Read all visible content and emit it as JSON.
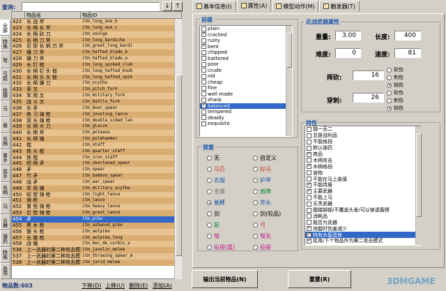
{
  "search": {
    "label": "查询:",
    "value": ""
  },
  "nav": {
    "down_icon": "↓",
    "up_icon": "↑"
  },
  "grid": {
    "col_name": "物品名",
    "col_id": "物品ID"
  },
  "vtabs": [
    "全部",
    "特殊",
    "弩",
    "弓箭",
    "投掷",
    "马",
    "盾",
    "长柄",
    "单手",
    "双手",
    "长柄",
    "马",
    "火器",
    "弹药",
    "特殊",
    "杂项"
  ],
  "rows": [
    {
      "n": "422",
      "name": "长 战 斧",
      "id": "itm_long_axe_b"
    },
    {
      "n": "423",
      "name": "长 柄 长 斧",
      "id": "itm_long_axe_c"
    },
    {
      "n": "424",
      "name": "长 柄 砍 刀",
      "id": "itm_voulge"
    },
    {
      "n": "425",
      "name": "长 柄 刀 斧",
      "id": "itm_long_bardiche"
    },
    {
      "n": "426",
      "name": "巨 型 长 柄 刃 斧",
      "id": "itm_great_long_bardi"
    },
    {
      "n": "427",
      "name": "镰 刀 斧",
      "id": "itm_hafted_blade_b"
    },
    {
      "n": "428",
      "name": "镰 刀 斧",
      "id": "itm_hafted_blade_a"
    },
    {
      "n": "429",
      "name": "长 钉 槌",
      "id": "itm_long_spiked_club"
    },
    {
      "n": "430",
      "name": "长 柄 钉 头 槌",
      "id": "itm_long_hafted_knob"
    },
    {
      "n": "431",
      "name": "长 柄 头 头 槌",
      "id": "itm_long_hafted_spik"
    },
    {
      "n": "432",
      "name": "长 柄 镰 刀",
      "id": "itm_scythe"
    },
    {
      "n": "433",
      "name": "草 叉",
      "id": "itm_pitch_fork"
    },
    {
      "n": "434",
      "name": "军 用 叉",
      "id": "itm_military_fork"
    },
    {
      "n": "435",
      "name": "战 斗 叉",
      "id": "itm_battle_fork"
    },
    {
      "n": "436",
      "name": "长 矛",
      "id": "itm_boar_spear"
    },
    {
      "n": "437",
      "name": "练 习 骑 枪",
      "id": "itm_jousting_lance"
    },
    {
      "n": "438",
      "name": "双 头 骑 枪",
      "id": "itm_double_sided_lan"
    },
    {
      "n": "439",
      "name": "长 柄 大 刀",
      "id": "itm_glaive"
    },
    {
      "n": "440",
      "name": "长 柄 斧",
      "id": "itm_poleaxe"
    },
    {
      "n": "441",
      "name": "长 柄 锤",
      "id": "itm_polehammer"
    },
    {
      "n": "442",
      "name": "棍",
      "id": "itm_staff"
    },
    {
      "n": "443",
      "name": "铁 头 棍",
      "id": "itm_quarter_staff"
    },
    {
      "n": "444",
      "name": "铁 棍",
      "id": "itm_iron_staff"
    },
    {
      "n": "445",
      "name": "短 柄 矛",
      "id": "itm_shortened_spear"
    },
    {
      "n": "446",
      "name": "矛",
      "id": "itm_spear"
    },
    {
      "n": "447",
      "name": "竹 矛",
      "id": "itm_bamboo_spear"
    },
    {
      "n": "448",
      "name": "战 矛",
      "id": "itm_war_spear"
    },
    {
      "n": "449",
      "name": "军 用 镰",
      "id": "itm_military_scythe"
    },
    {
      "n": "450",
      "name": "轻 型 骑 枪",
      "id": "itm_light_lance"
    },
    {
      "n": "451",
      "name": "骑 枪",
      "id": "itm_lance"
    },
    {
      "n": "452",
      "name": "重 型 骑 枪",
      "id": "itm_heavy_lance"
    },
    {
      "n": "453",
      "name": "巨 型 骑 枪",
      "id": "itm_great_lance"
    },
    {
      "n": "454",
      "name": "矛",
      "id": "itm_pike"
    },
    {
      "n": "455",
      "name": "黑 木 枪",
      "id": "itm_ashwood_pike"
    },
    {
      "n": "456",
      "name": "锥 头 枪",
      "id": "itm_awlpike"
    },
    {
      "n": "457",
      "name": "长 锥 枪",
      "id": "itm_awlpike_long"
    },
    {
      "n": "458",
      "name": "战 锤",
      "id": "itm_bec_de_corbin_a"
    },
    {
      "n": "536",
      "name": "上一武器的第二种攻击模式",
      "id": "itm_javelin_melee"
    },
    {
      "n": "537",
      "name": "上一武器的第二种攻击模式",
      "id": "itm_throwing_spear_m"
    },
    {
      "n": "538",
      "name": "上一武器的第二种攻击模式",
      "id": "itm_jarid_melee"
    }
  ],
  "selected_row": 32,
  "footer": {
    "count_label": "物品数:",
    "count": "603",
    "down": "下移(D)",
    "up": "上移(U)",
    "delete": "删除(E)",
    "add": "添加(A)"
  },
  "tabs": [
    {
      "icon": "basic-info-icon",
      "label": "基本信息(I)"
    },
    {
      "icon": "attributes-icon",
      "label": "属性(A)"
    },
    {
      "icon": "model-action-icon",
      "label": "模型动作(M)"
    },
    {
      "icon": "trigger-icon",
      "label": "触发器(T)"
    }
  ],
  "prefix": {
    "title": "前缀",
    "items": [
      {
        "t": "plain",
        "on": false
      },
      {
        "t": "cracked",
        "on": true
      },
      {
        "t": "rusty",
        "on": false
      },
      {
        "t": "bent",
        "on": true
      },
      {
        "t": "chipped",
        "on": false
      },
      {
        "t": "battered",
        "on": false
      },
      {
        "t": "poor",
        "on": false
      },
      {
        "t": "crude",
        "on": false
      },
      {
        "t": "old",
        "on": false
      },
      {
        "t": "cheap",
        "on": false
      },
      {
        "t": "fine",
        "on": false
      },
      {
        "t": "well made",
        "on": false
      },
      {
        "t": "sharp",
        "on": false
      },
      {
        "t": "balanced",
        "on": true
      },
      {
        "t": "tempered",
        "on": false
      },
      {
        "t": "deadly",
        "on": false
      },
      {
        "t": "exquisite",
        "on": false
      }
    ],
    "selected": 13
  },
  "melee": {
    "title": "近战武器属性",
    "weight_label": "重量:",
    "weight": "3.00",
    "length_label": "长度:",
    "length": "400",
    "difficulty_label": "难度:",
    "difficulty": "0",
    "speed_label": "速度:",
    "speed": "81",
    "swing_label": "挥砍:",
    "swing": "16",
    "thrust_label": "穿刺:",
    "thrust": "26",
    "swing_types": [
      "砍伤",
      "刺伤",
      "钝伤"
    ],
    "swing_sel": 2,
    "thrust_types": [
      "砍伤",
      "刺伤",
      "钝伤"
    ],
    "thrust_sel": 2
  },
  "presets": {
    "title": "预置",
    "items": [
      {
        "t": "无",
        "c": "#000000"
      },
      {
        "t": "自定义",
        "c": "#000000"
      },
      {
        "t": "马匹",
        "c": "#c8402a"
      },
      {
        "t": "好马",
        "c": "#c8402a"
      },
      {
        "t": "衣服",
        "c": "#1e5aa8"
      },
      {
        "t": "护甲",
        "c": "#1e5aa8"
      },
      {
        "t": "金属",
        "c": "#707070"
      },
      {
        "t": "盾牌",
        "c": "#0b8a3a"
      },
      {
        "t": "长杆",
        "c": "#1e5aa8"
      },
      {
        "t": "斧头",
        "c": "#1e5aa8"
      },
      {
        "t": "剑",
        "c": "#000000"
      },
      {
        "t": "剑(较品)",
        "c": "#000000"
      },
      {
        "t": "箭",
        "c": "#0b8a3a"
      },
      {
        "t": "弓",
        "c": "#c8402a"
      },
      {
        "t": "弩",
        "c": "#c0208a"
      },
      {
        "t": "弩矢",
        "c": "#c0208a"
      },
      {
        "t": "投掷(重)",
        "c": "#c0208a"
      },
      {
        "t": "投掷",
        "c": "#c0208a"
      }
    ],
    "selected": 8
  },
  "traits": {
    "title": "特性",
    "items": [
      {
        "t": "独一无二",
        "on": false
      },
      {
        "t": "总是战利品",
        "on": false
      },
      {
        "t": "不能格挡",
        "on": false
      },
      {
        "t": "默认弹药",
        "on": false
      },
      {
        "t": "商品",
        "on": true
      },
      {
        "t": "木柄攻击",
        "on": false
      },
      {
        "t": "木柄格挡",
        "on": true
      },
      {
        "t": "食物",
        "on": false
      },
      {
        "t": "不能在马上装填",
        "on": false
      },
      {
        "t": "不能持盾",
        "on": true
      },
      {
        "t": "主要武器",
        "on": true
      },
      {
        "t": "不能上马",
        "on": false
      },
      {
        "t": "无责武器",
        "on": false
      },
      {
        "t": "蹬踏脚部/不覆盖头发/可以穿透盾牌",
        "on": false
      },
      {
        "t": "消耗品",
        "on": false
      },
      {
        "t": "能否为武器",
        "on": false
      },
      {
        "t": "持握时伤害减少",
        "on": true
      },
      {
        "t": "特有头盔音效",
        "on": true
      },
      {
        "t": "民用/下个物品作为第二攻击模式",
        "on": true
      }
    ],
    "selected": 17
  },
  "bottom": {
    "export": "输出当前物品(N)",
    "reset": "重置(R)"
  },
  "watermark": "3DMGAME"
}
